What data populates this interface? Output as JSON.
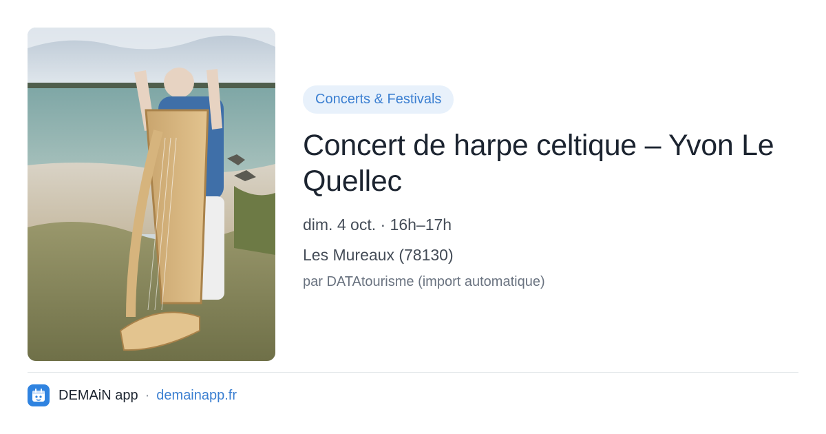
{
  "event": {
    "category": "Concerts & Festivals",
    "title": "Concert de harpe celtique – Yvon Le Quellec",
    "datetime": "dim. 4 oct. · 16h–17h",
    "location": "Les Mureaux (78130)",
    "source": "par DATAtourisme (import automatique)",
    "image_alt": "harpist-on-beach-photo"
  },
  "footer": {
    "app_name": "DEMAiN app",
    "separator": "·",
    "site_link": "demainapp.fr",
    "app_icon": "calendar-icon"
  },
  "colors": {
    "accent": "#3b7fd1",
    "badge_bg": "#e8f1fb",
    "title": "#1c2430",
    "app_icon_bg": "#2f83e0"
  }
}
